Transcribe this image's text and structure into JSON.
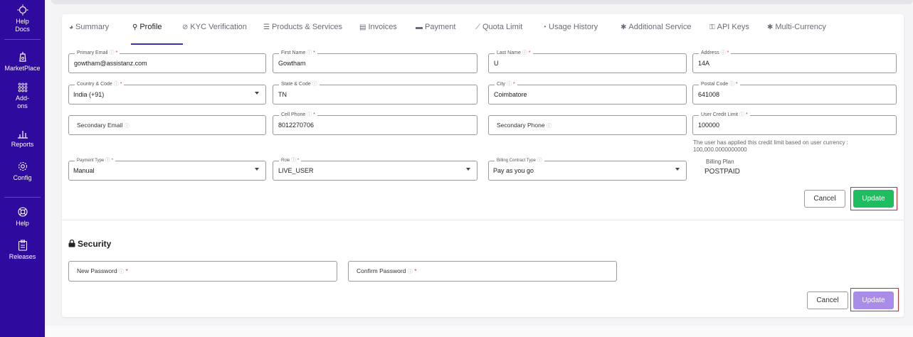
{
  "sidebar": {
    "items": [
      {
        "label1": "Help",
        "label2": "Docs",
        "icon": "bulb-icon"
      },
      {
        "label1": "MarketPlace",
        "label2": "",
        "icon": "marketplace-icon"
      },
      {
        "label1": "Add-",
        "label2": "ons",
        "icon": "grid-icon"
      },
      {
        "label1": "Reports",
        "label2": "",
        "icon": "bar-chart-icon"
      },
      {
        "label1": "Config",
        "label2": "",
        "icon": "gear-icon"
      },
      {
        "label1": "Help",
        "label2": "",
        "icon": "lifebuoy-icon"
      },
      {
        "label1": "Releases",
        "label2": "",
        "icon": "clipboard-icon"
      }
    ]
  },
  "tabs": [
    {
      "label": "Summary",
      "icon": "dashboard-icon"
    },
    {
      "label": "Profile",
      "icon": "user-icon",
      "active": true
    },
    {
      "label": "KYC Verification",
      "icon": "check-circle-icon"
    },
    {
      "label": "Products & Services",
      "icon": "list-icon"
    },
    {
      "label": "Invoices",
      "icon": "document-icon"
    },
    {
      "label": "Payment",
      "icon": "money-icon"
    },
    {
      "label": "Quota Limit",
      "icon": "line-chart-icon"
    },
    {
      "label": "Usage History",
      "icon": "pie-chart-icon"
    },
    {
      "label": "Additional Service",
      "icon": "cog-icon"
    },
    {
      "label": "API Keys",
      "icon": "key-icon"
    },
    {
      "label": "Multi-Currency",
      "icon": "cog-icon"
    }
  ],
  "profile": {
    "primary_email": {
      "label": "Primary Email",
      "value": "gowtham@assistanz.com"
    },
    "first_name": {
      "label": "First Name",
      "value": "Gowtham"
    },
    "last_name": {
      "label": "Last Name",
      "value": "U"
    },
    "address": {
      "label": "Address",
      "value": "14A"
    },
    "country_code": {
      "label": "Country & Code",
      "value": "India (+91)"
    },
    "state_code": {
      "label": "State & Code",
      "value": "TN"
    },
    "city": {
      "label": "City",
      "value": "Coimbatore"
    },
    "postal_code": {
      "label": "Postal Code",
      "value": "641008"
    },
    "secondary_email": {
      "placeholder": "Secondary Email"
    },
    "cell_phone": {
      "label": "Cell Phone",
      "value": "8012270706"
    },
    "secondary_phone": {
      "placeholder": "Secondary Phone"
    },
    "user_credit_limit": {
      "label": "User Credit Limit",
      "value": "100000"
    },
    "credit_note": "The user has applied this credit limit based on user currency : 100,000.0000000000",
    "payment_type": {
      "label": "Payment Type",
      "value": "Manual"
    },
    "role": {
      "label": "Role",
      "value": "LIVE_USER"
    },
    "billing_contract_type": {
      "label": "Billing Contract Type",
      "value": "Pay as you go"
    },
    "billing_plan": {
      "label": "Billing Plan",
      "value": "POSTPAID"
    },
    "cancel_label": "Cancel",
    "update_label": "Update"
  },
  "security": {
    "title": "Security",
    "new_password": {
      "placeholder": "New Password"
    },
    "confirm_password": {
      "placeholder": "Confirm Password"
    },
    "cancel_label": "Cancel",
    "update_label": "Update"
  },
  "colors": {
    "sidebar": "#2e0a9e",
    "update_active": "#1ebd5f",
    "update_disabled": "#a98be8",
    "highlight": "#d42a2a"
  }
}
